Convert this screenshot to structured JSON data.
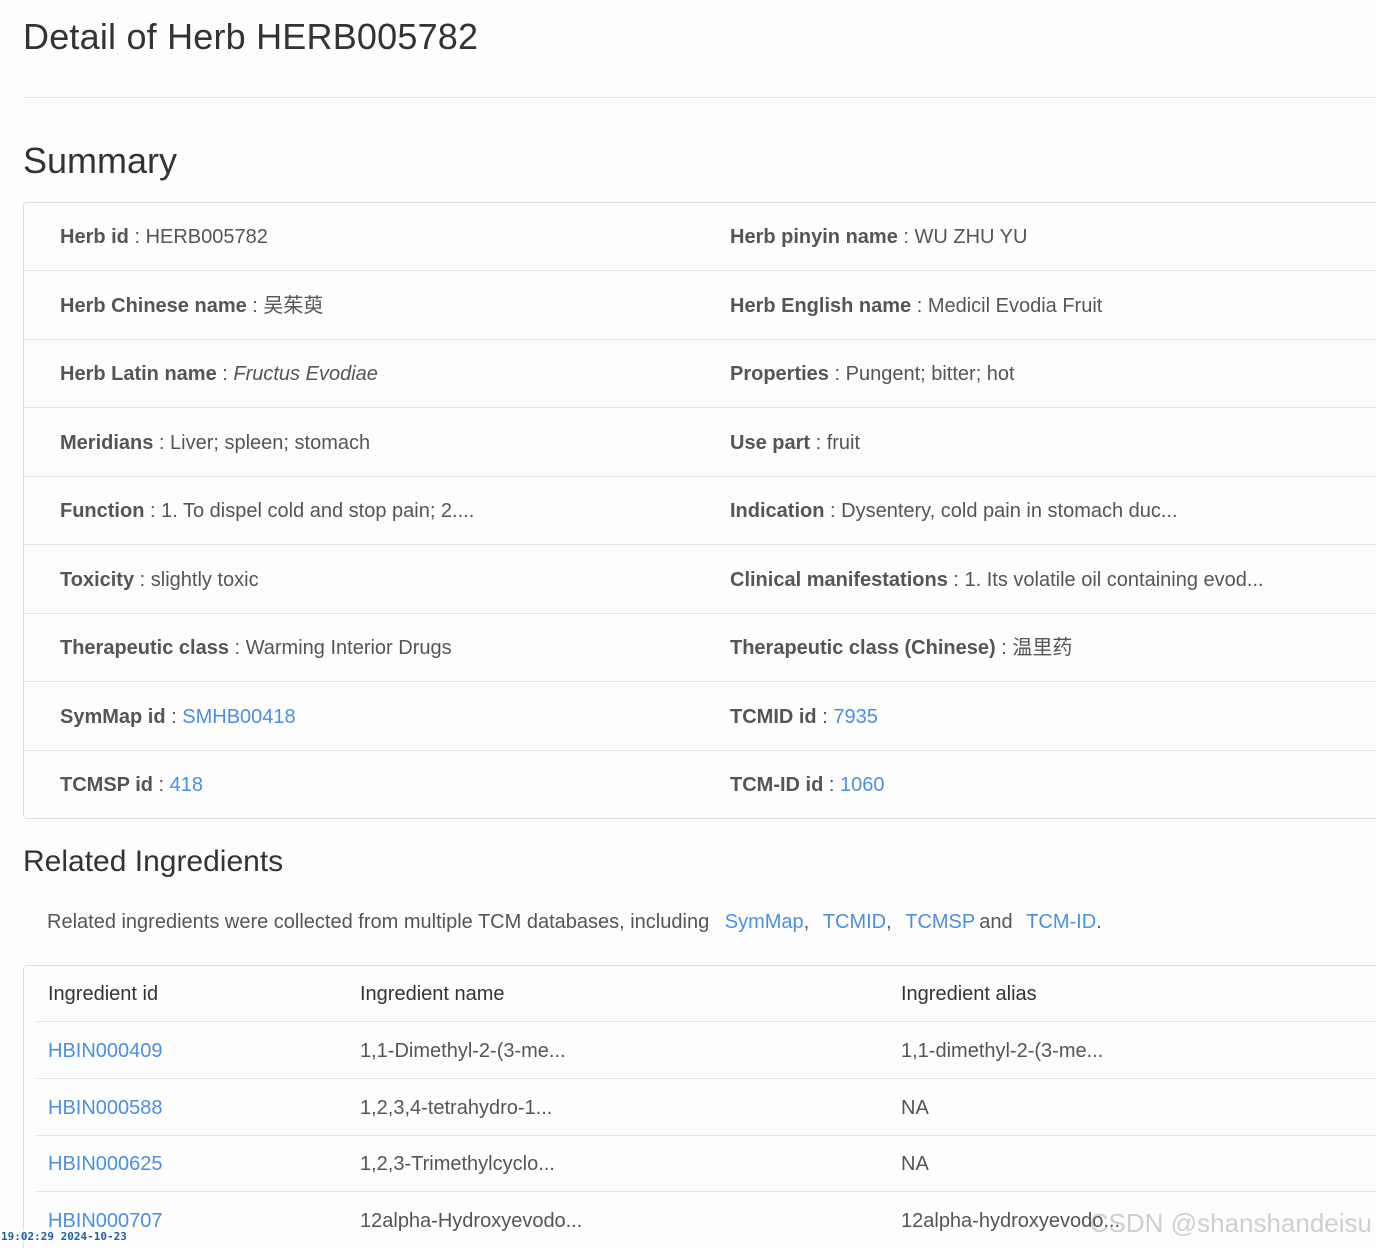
{
  "page": {
    "title": "Detail of Herb HERB005782"
  },
  "summary": {
    "heading": "Summary",
    "separator": " : ",
    "rows": [
      {
        "left": {
          "label": "Herb id",
          "value": "HERB005782"
        },
        "right": {
          "label": "Herb pinyin name",
          "value": "WU ZHU YU"
        }
      },
      {
        "left": {
          "label": "Herb Chinese name",
          "value": "吴茱萸"
        },
        "right": {
          "label": "Herb English name",
          "value": "Medicil Evodia Fruit"
        }
      },
      {
        "left": {
          "label": "Herb Latin name",
          "value": "Fructus Evodiae"
        },
        "right": {
          "label": "Properties",
          "value": "Pungent; bitter; hot"
        }
      },
      {
        "left": {
          "label": "Meridians",
          "value": "Liver; spleen; stomach"
        },
        "right": {
          "label": "Use part",
          "value": "fruit"
        }
      },
      {
        "left": {
          "label": "Function",
          "value": "1. To dispel cold and stop pain; 2...."
        },
        "right": {
          "label": "Indication",
          "value": "Dysentery, cold pain in stomach duc..."
        }
      },
      {
        "left": {
          "label": "Toxicity",
          "value": "slightly toxic"
        },
        "right": {
          "label": "Clinical manifestations",
          "value": "1. Its volatile oil containing evod..."
        }
      },
      {
        "left": {
          "label": "Therapeutic class",
          "value": "Warming Interior Drugs"
        },
        "right": {
          "label": "Therapeutic class (Chinese)",
          "value": "温里药"
        }
      },
      {
        "left": {
          "label": "SymMap id",
          "value": "SMHB00418"
        },
        "right": {
          "label": "TCMID id",
          "value": "7935"
        }
      },
      {
        "left": {
          "label": "TCMSP id",
          "value": "418"
        },
        "right": {
          "label": "TCM-ID id",
          "value": "1060"
        }
      }
    ]
  },
  "related": {
    "heading": "Related Ingredients",
    "description_prefix": "Related ingredients were collected from multiple TCM databases, including",
    "links": [
      "SymMap",
      "TCMID",
      "TCMSP",
      "TCM-ID"
    ],
    "comma": ",",
    "and_word": "and",
    "period": ".",
    "table": {
      "columns": [
        "Ingredient id",
        "Ingredient name",
        "Ingredient alias"
      ],
      "rows": [
        {
          "id": "HBIN000409",
          "name": "1,1-Dimethyl-2-(3-me...",
          "alias": "1,1-dimethyl-2-(3-me..."
        },
        {
          "id": "HBIN000588",
          "name": "1,2,3,4-tetrahydro-1...",
          "alias": "NA"
        },
        {
          "id": "HBIN000625",
          "name": "1,2,3-Trimethylcyclo...",
          "alias": "NA"
        },
        {
          "id": "HBIN000707",
          "name": "12alpha-Hydroxyevodo...",
          "alias": "12alpha-hydroxyevodo..."
        }
      ]
    }
  },
  "overlay": {
    "timestamp": "19:02:29 2024-10-23",
    "watermark": "CSDN @shanshandeisu"
  },
  "colors": {
    "link": "#4a90e2",
    "text": "#555555",
    "heading": "#333333",
    "border": "#e6e6e6"
  }
}
